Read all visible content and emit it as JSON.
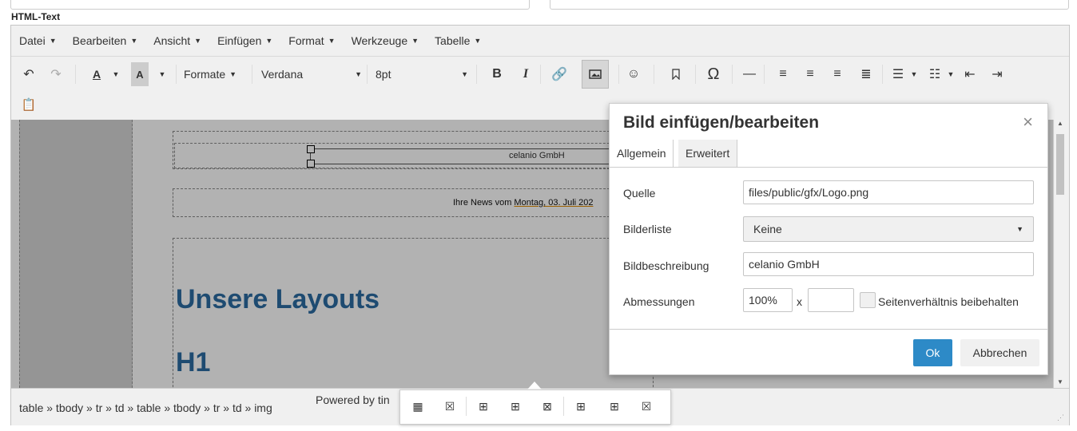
{
  "field_label": "HTML-Text",
  "menubar": [
    {
      "label": "Datei"
    },
    {
      "label": "Bearbeiten"
    },
    {
      "label": "Ansicht"
    },
    {
      "label": "Einfügen"
    },
    {
      "label": "Format"
    },
    {
      "label": "Werkzeuge"
    },
    {
      "label": "Tabelle"
    }
  ],
  "toolbar": {
    "formats_label": "Formate",
    "font_family": "Verdana",
    "font_size": "8pt",
    "bold": "B",
    "italic": "I",
    "omega": "Ω"
  },
  "content": {
    "header_company": "celanio GmbH",
    "news_prefix": "Ihre News vom ",
    "news_date": "Montag, 03. Juli 202",
    "heading_layouts": "Unsere Layouts",
    "heading_h1": "H1"
  },
  "statusbar": {
    "path": "table » tbody » tr » td » table » tbody » tr » td » img",
    "powered_by": "Powered by tin"
  },
  "dialog": {
    "title": "Bild einfügen/bearbeiten",
    "close": "×",
    "tabs": [
      {
        "label": "Allgemein"
      },
      {
        "label": "Erweitert"
      }
    ],
    "source_label": "Quelle",
    "source_value": "files/public/gfx/Logo.png",
    "imagelist_label": "Bilderliste",
    "imagelist_value": "Keine",
    "description_label": "Bildbeschreibung",
    "description_value": "celanio GmbH",
    "dimensions_label": "Abmessungen",
    "width_value": "100%",
    "height_value": "",
    "x_label": "x",
    "keep_ratio_label": "Seitenverhältnis beibehalten",
    "ok_label": "Ok",
    "cancel_label": "Abbrechen"
  },
  "colors": {
    "accent": "#2d8ac7",
    "heading": "#2b6ca3"
  }
}
